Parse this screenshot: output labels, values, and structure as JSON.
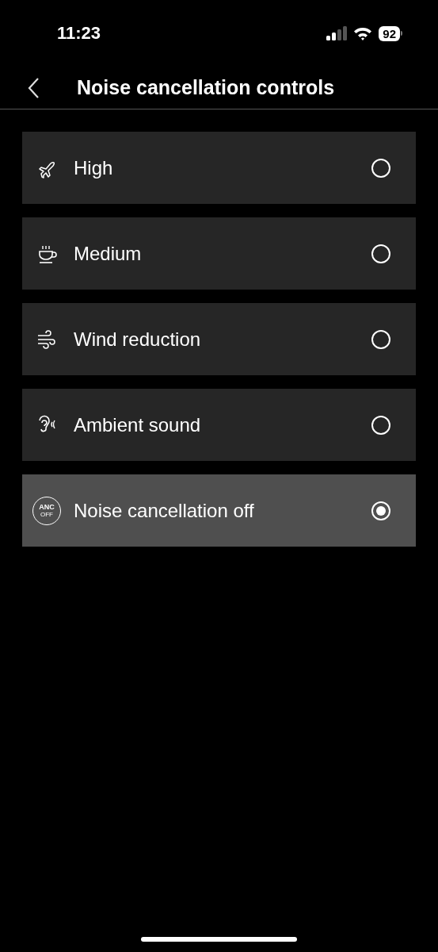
{
  "status_bar": {
    "time": "11:23",
    "battery": "92"
  },
  "header": {
    "title": "Noise cancellation controls"
  },
  "options": [
    {
      "kind": "plane",
      "label": "High",
      "selected": false
    },
    {
      "kind": "cup",
      "label": "Medium",
      "selected": false
    },
    {
      "kind": "wind",
      "label": "Wind reduction",
      "selected": false
    },
    {
      "kind": "ear",
      "label": "Ambient sound",
      "selected": false
    },
    {
      "kind": "anc",
      "label": "Noise cancellation off",
      "selected": true,
      "icon_text": [
        "ANC",
        "OFF"
      ]
    }
  ]
}
